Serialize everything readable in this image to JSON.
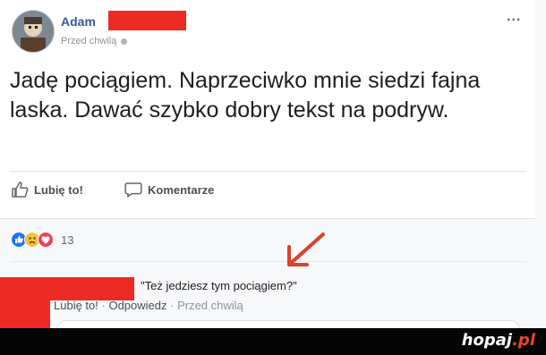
{
  "post": {
    "author": "Adam",
    "timestamp": "Przed chwilą",
    "more_icon": "...",
    "text": "Jadę pociągiem. Naprzeciwko mnie siedzi fajna laska. Dawać szybko dobry tekst na podryw.",
    "like_label": "Lubię to!",
    "comment_label": "Komentarze",
    "reaction_count": "13",
    "reactions": [
      "like-icon",
      "sad-icon",
      "love-icon"
    ]
  },
  "comment": {
    "text": "\"Też jedziesz tym pociągiem?\"",
    "like": "Lubię to!",
    "reply": "Odpowiedz",
    "time": "Przed chwilą"
  },
  "footer": {
    "brand": "hopaj",
    "brand_tld": ".pl"
  },
  "colors": {
    "redaction": "#ee2a24",
    "link": "#365899",
    "arrow": "#d9412c"
  }
}
